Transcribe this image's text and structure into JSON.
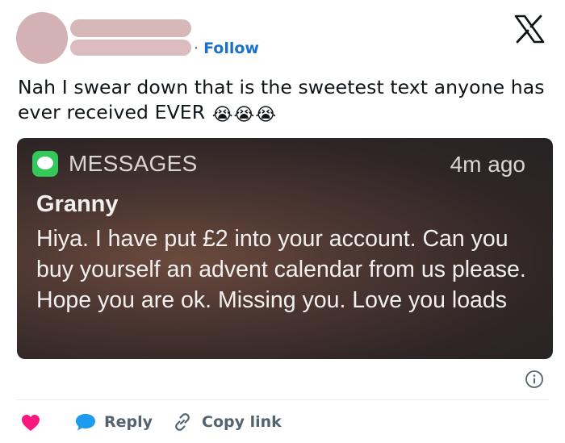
{
  "header": {
    "follow_separator": "·",
    "follow_label": "Follow"
  },
  "post": {
    "text": "Nah I swear down that is the sweetest text anyone has ever received EVER",
    "emojis": [
      "😭",
      "😭",
      "😭"
    ]
  },
  "notification": {
    "app_name": "MESSAGES",
    "time": "4m ago",
    "sender": "Granny",
    "body": "Hiya. I have put £2 into your account. Can you buy yourself an advent calendar from us please. Hope you are ok. Missing you. Love you loads"
  },
  "actions": {
    "reply_label": "Reply",
    "copy_link_label": "Copy link"
  },
  "icons": {
    "brand": "x-logo",
    "like": "heart-icon",
    "reply": "speech-bubble-icon",
    "copy": "link-icon",
    "info": "info-icon"
  },
  "colors": {
    "follow_link": "#1d71c8",
    "like": "#f91880",
    "reply": "#1d9bf0",
    "messages_app": "#34c759",
    "secondary_text": "#536471"
  }
}
